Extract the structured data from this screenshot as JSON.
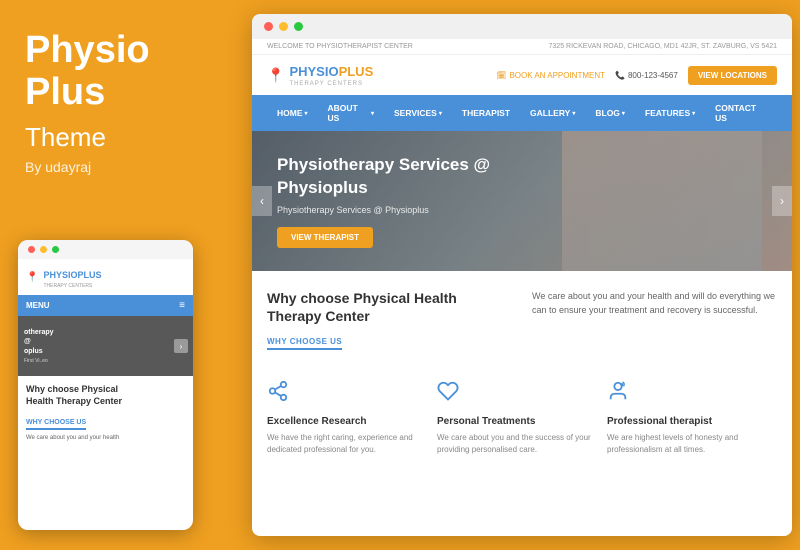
{
  "left": {
    "title": "Physio\nPlus",
    "subtitle": "Theme",
    "author": "By udayraj"
  },
  "mobile": {
    "logo_text": "PHYSIOPLUS",
    "logo_sub": "THERAPY CENTERS",
    "menu_label": "MENU",
    "hero_line1": "otherapy",
    "hero_line2": "@",
    "hero_line3": "oplus",
    "hero_badge": "First Vi..eo",
    "section_title": "Why choose Physical\nHealth Therapy Center",
    "why_label": "WHY CHOOSE US",
    "body_text": "We care about you and your health"
  },
  "browser": {
    "topbar_left": "WELCOME TO PHYSIOTHERAPIST CENTER",
    "topbar_right": "7325 RICKEVAN ROAD, CHICAGO, MD1 42JR, ST. ZAVBURG, VS 5421",
    "logo_text": "PHYSIO",
    "logo_plus": "PLUS",
    "logo_sub": "THERAPY CENTERS",
    "book_appt": "BOOK AN APPOINTMENT",
    "phone": "800-123-4567",
    "view_locations": "VIEW LOCATIONS",
    "nav": [
      {
        "label": "HOME",
        "has_arrow": true
      },
      {
        "label": "ABOUT US",
        "has_arrow": true
      },
      {
        "label": "SERVICES",
        "has_arrow": true
      },
      {
        "label": "THERAPIST",
        "has_arrow": false
      },
      {
        "label": "GALLERY",
        "has_arrow": true
      },
      {
        "label": "BLOG",
        "has_arrow": true
      },
      {
        "label": "FEATURES",
        "has_arrow": true
      },
      {
        "label": "CONTACT US",
        "has_arrow": false
      }
    ],
    "hero_title": "Physiotherapy Services @\nPhysioplus",
    "hero_subtitle": "Physiotherapy Services @ Physioplus",
    "hero_btn": "VIEW THERAPIST",
    "why_title": "Why choose Physical Health\nTherapy Center",
    "why_label": "WHY CHOOSE US",
    "why_body": "We care about you and your health and will do everything we can to ensure your treatment and recovery is successful.",
    "features": [
      {
        "icon": "share",
        "title": "Excellence Research",
        "desc": "We have the right caring, experience and dedicated professional for you."
      },
      {
        "icon": "heart",
        "title": "Personal Treatments",
        "desc": "We care about you and the success of your providing personalised care."
      },
      {
        "icon": "person",
        "title": "Professional therapist",
        "desc": "We are highest levels of honesty and professionalism at all times."
      }
    ]
  }
}
